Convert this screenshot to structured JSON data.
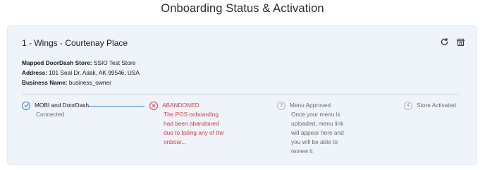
{
  "page": {
    "title": "Onboarding Status & Activation"
  },
  "store_card": {
    "title": "1 - Wings - Courtenay Place",
    "icons": {
      "refresh": "refresh-icon",
      "store": "store-icon"
    },
    "details": {
      "mapped_label": "Mapped DoorDash Store:",
      "mapped_value": "SSIO Test Store",
      "address_label": "Address:",
      "address_value": "101 Seal Dr, Adak, AK 99546, USA",
      "business_label": "Business Name:",
      "business_value": "business_owner"
    }
  },
  "steps": [
    {
      "marker": "check",
      "label": "MOBI and DoorDash",
      "description": "Connected",
      "status": "complete"
    },
    {
      "marker": "x",
      "label": "ABANDONED",
      "description": "The POS onboarding had been abandoned due to failing any of the onboar...",
      "status": "error"
    },
    {
      "marker": "3",
      "label": "Menu Approved",
      "description": "Once your menu is uploaded, menu link will appear here and you will be able to review it",
      "status": "pending"
    },
    {
      "marker": "4",
      "label": "Store Activated",
      "description": "",
      "status": "pending"
    }
  ],
  "colors": {
    "accent": "#3d7fd6",
    "error": "#e53a3a",
    "muted": "#6b6b6b",
    "card_bg": "#eef4f9"
  }
}
